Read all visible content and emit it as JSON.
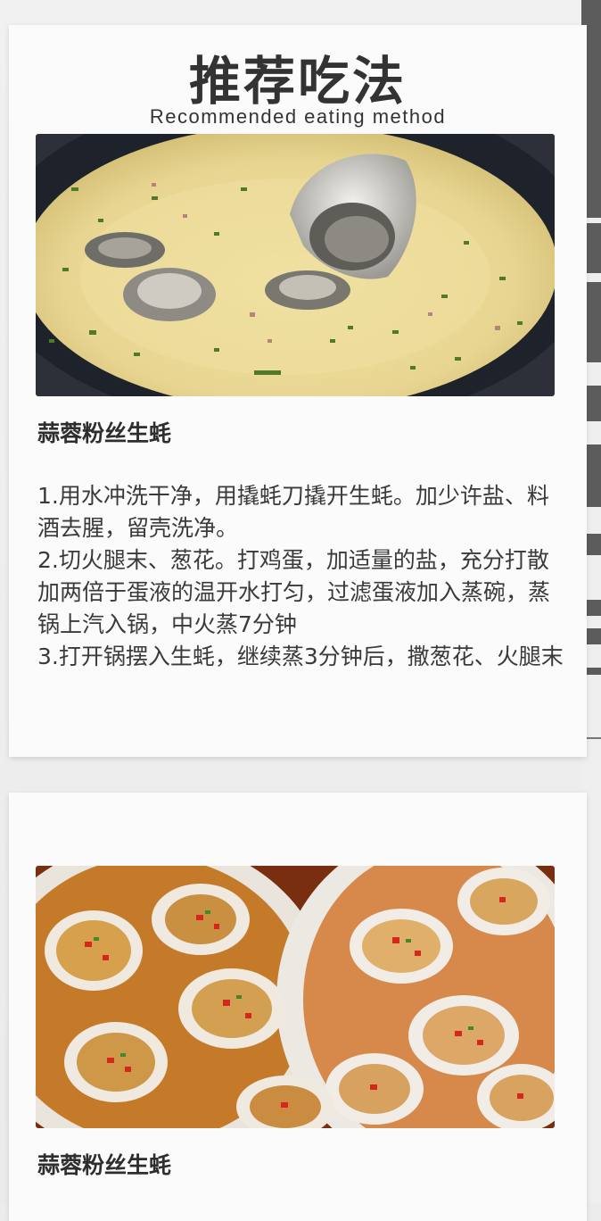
{
  "section": {
    "title": "推荐吃法",
    "subtitle": "Recommended eating method"
  },
  "recipes": [
    {
      "name": "蒜蓉粉丝生蚝",
      "image": "steamed-egg-oyster-photo",
      "steps": [
        "1.用水冲洗干净，用撬蚝刀撬开生蚝。加少许盐、料酒去腥，留壳洗净。",
        "2.切火腿末、葱花。打鸡蛋，加适量的盐，充分打散加两倍于蛋液的温开水打匀，过滤蛋液加入蒸碗，蒸锅上汽入锅，中火蒸7分钟",
        "3.打开锅摆入生蚝，继续蒸3分钟后，撒葱花、火腿末"
      ]
    },
    {
      "name": "蒜蓉粉丝生蚝",
      "image": "garlic-vermicelli-oyster-photo"
    }
  ],
  "colors": {
    "background": "#ececec",
    "card": "#fbfbfb",
    "text": "#333333",
    "stripe": "#5c5c5c"
  }
}
